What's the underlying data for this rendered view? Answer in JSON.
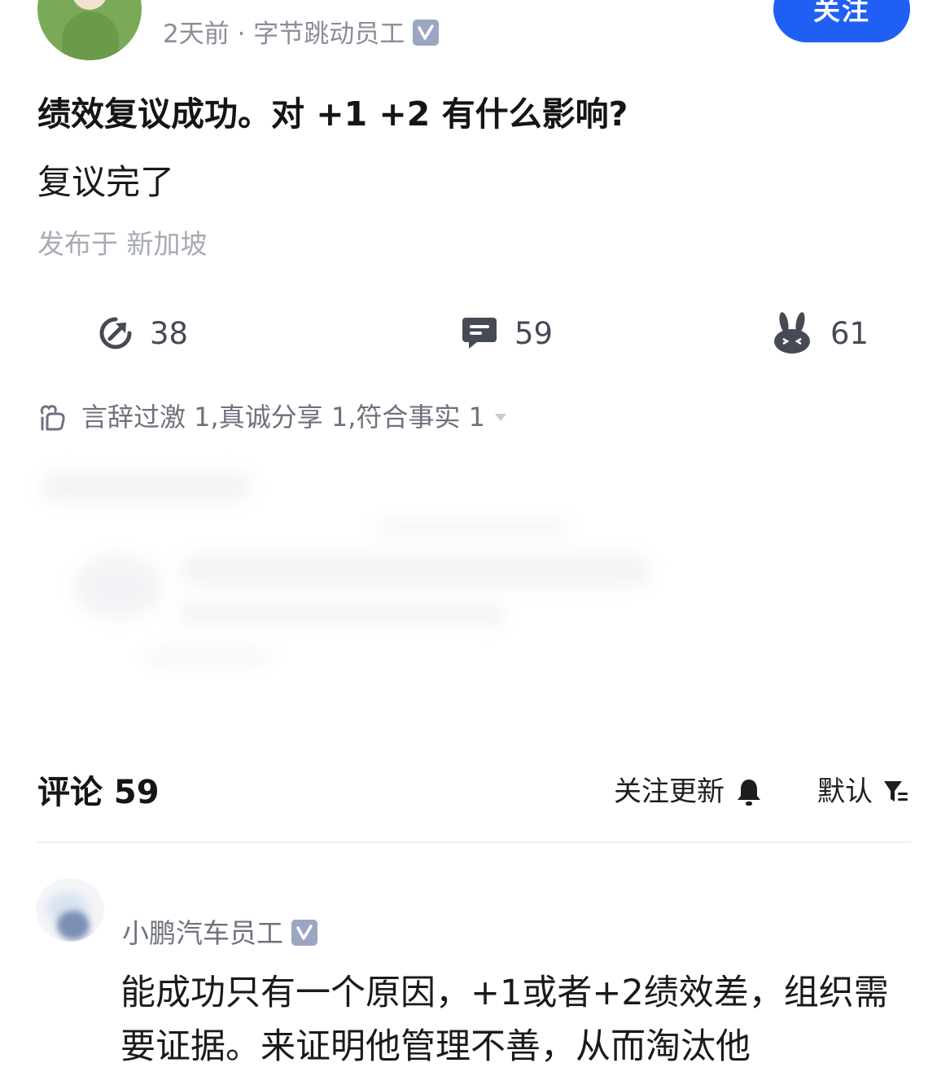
{
  "post": {
    "meta": "2天前 · 字节跳动员工",
    "follow_label": "关注",
    "title": "绩效复议成功。对 +1 +2 有什么影响?",
    "body": "复议完了",
    "location": "发布于 新加坡"
  },
  "stats": {
    "share_count": "38",
    "comment_count": "59",
    "like_count": "61"
  },
  "reactions": {
    "text": "言辞过激 1,真诚分享 1,符合事实 1"
  },
  "comments": {
    "title": "评论 59",
    "follow_updates_label": "关注更新",
    "sort_label": "默认",
    "items": [
      {
        "author": "小鹏汽车员工",
        "text": "能成功只有一个原因，+1或者+2绩效差，组织需要证据。来证明他管理不善，从而淘汰他"
      }
    ]
  },
  "colors": {
    "accent": "#1f5ff3",
    "muted_text": "#8a8e99"
  },
  "icons": [
    "verified-icon",
    "share-icon",
    "comment-icon",
    "bunny-icon",
    "reaction-icon",
    "caret-down-icon",
    "bell-icon",
    "filter-icon"
  ]
}
